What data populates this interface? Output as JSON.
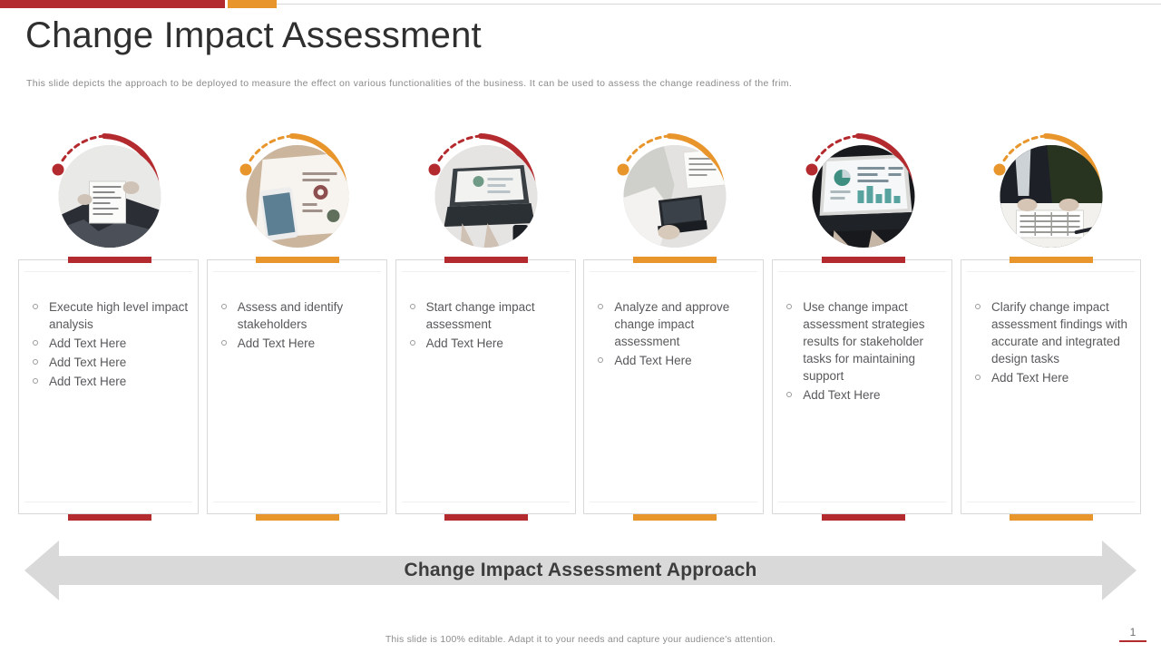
{
  "theme": {
    "red": "#b42b2f",
    "orange": "#e8952c",
    "text_gray": "#58595b",
    "band_gray": "#d9d9d9"
  },
  "header": {
    "title": "Change Impact Assessment",
    "subtitle": "This slide depicts the approach to be deployed to measure the effect on various functionalities of the business. It can be used to assess the change readiness of the frim."
  },
  "columns": [
    {
      "accent": "#b42b2f",
      "photo_name": "photo-person-reading-document",
      "bullets": [
        "Execute high level impact analysis",
        "Add Text Here",
        "Add Text Here",
        "Add Text Here"
      ]
    },
    {
      "accent": "#e8952c",
      "photo_name": "photo-phone-and-charts-on-desk",
      "bullets": [
        "Assess and identify stakeholders",
        "Add Text Here"
      ]
    },
    {
      "accent": "#b42b2f",
      "photo_name": "photo-hands-typing-on-laptop",
      "bullets": [
        "Start change impact assessment",
        "Add Text Here"
      ]
    },
    {
      "accent": "#e8952c",
      "photo_name": "photo-person-working-on-laptop-with-papers",
      "bullets": [
        "Analyze and approve change impact assessment",
        "Add Text Here"
      ]
    },
    {
      "accent": "#b42b2f",
      "photo_name": "photo-laptop-dashboard-analytics",
      "bullets": [
        "Use change impact assessment strategies results for stakeholder tasks for maintaining support",
        "Add Text Here"
      ]
    },
    {
      "accent": "#e8952c",
      "photo_name": "photo-businessman-reviewing-spreadsheet",
      "bullets": [
        "Clarify change impact assessment findings with accurate and integrated design tasks",
        "Add Text Here"
      ]
    }
  ],
  "arrow_band": {
    "label": "Change Impact Assessment Approach"
  },
  "footer": {
    "note": "This slide is 100% editable. Adapt it to your needs and capture your audience's attention.",
    "page_number": "1"
  }
}
